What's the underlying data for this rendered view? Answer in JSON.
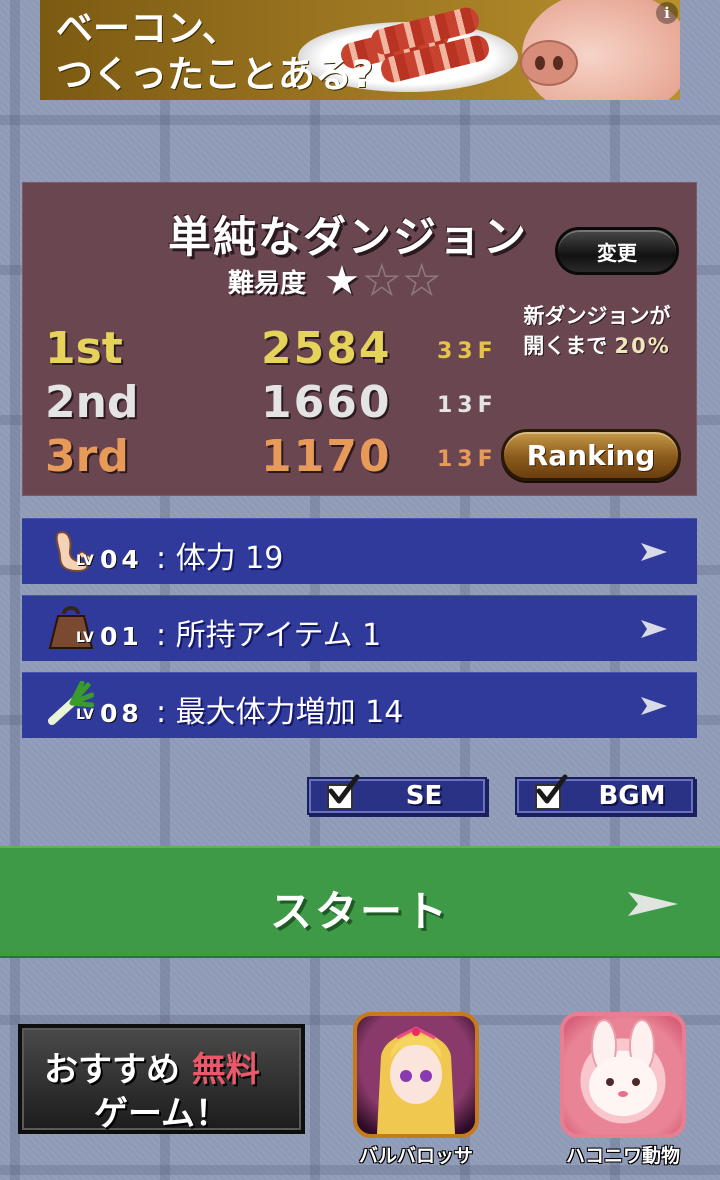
{
  "ad": {
    "line1": "ベーコン、",
    "line2": "つくったことある?",
    "info_icon": "info-icon"
  },
  "dungeon": {
    "title": "単純なダンジョン",
    "change_label": "変更",
    "difficulty_label": "難易度",
    "difficulty_stars": 1,
    "difficulty_max": 3,
    "rankings": [
      {
        "pos": "1st",
        "score": "2584",
        "floor": "33F"
      },
      {
        "pos": "2nd",
        "score": "1660",
        "floor": "13F"
      },
      {
        "pos": "3rd",
        "score": "1170",
        "floor": "13F"
      }
    ],
    "unlock_line1": "新ダンジョンが",
    "unlock_line2_prefix": "開くまで",
    "unlock_percent": "20%",
    "ranking_label": "Ranking"
  },
  "upgrades": [
    {
      "icon": "foot-icon",
      "lv_label": "LV",
      "level": "04",
      "text": ": 体力 19"
    },
    {
      "icon": "bag-icon",
      "lv_label": "LV",
      "level": "01",
      "text": ": 所持アイテム 1"
    },
    {
      "icon": "leek-icon",
      "lv_label": "LV",
      "level": "08",
      "text": ": 最大体力増加 14"
    }
  ],
  "toggles": {
    "se": {
      "label": "SE",
      "checked": true
    },
    "bgm": {
      "label": "BGM",
      "checked": true
    }
  },
  "start_label": "スタート",
  "recommend": {
    "prefix": "おすすめ",
    "free": "無料",
    "line2": "ゲーム！"
  },
  "apps": [
    {
      "name": "バルバロッサ",
      "icon": "barbarossa-app-icon"
    },
    {
      "name": "ハコニワ動物",
      "icon": "hakoniwa-animal-app-icon"
    }
  ],
  "colors": {
    "panel": "#6a4651",
    "upgrade_row": "#2f3a9a",
    "start_bar": "#3f9a48",
    "gold": "#e6d45a",
    "silver": "#e4e4e4",
    "bronze": "#e89a58"
  }
}
